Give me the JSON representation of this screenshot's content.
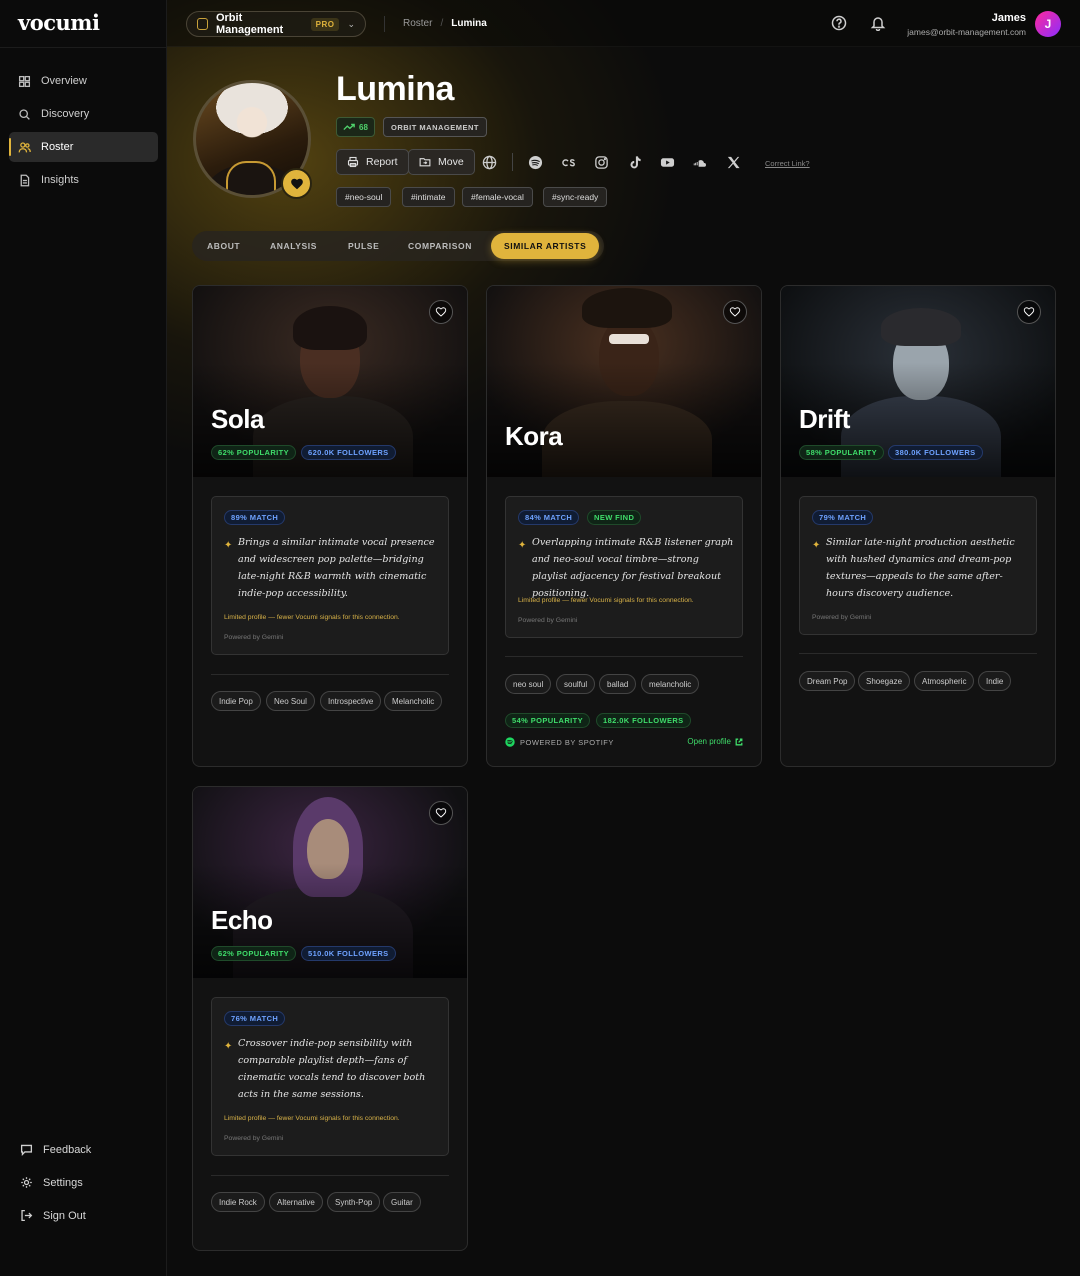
{
  "brand": {
    "logo": "vocumi",
    "accent": "#e0b43c"
  },
  "sidebar": {
    "items": [
      {
        "label": "Overview",
        "icon": "grid-icon"
      },
      {
        "label": "Discovery",
        "icon": "search-icon"
      },
      {
        "label": "Roster",
        "icon": "users-icon",
        "active": true
      },
      {
        "label": "Insights",
        "icon": "document-icon"
      }
    ],
    "bottom": [
      {
        "label": "Feedback",
        "icon": "chat-icon"
      },
      {
        "label": "Settings",
        "icon": "gear-icon"
      },
      {
        "label": "Sign Out",
        "icon": "logout-icon"
      }
    ]
  },
  "topbar": {
    "org_name": "Orbit Management",
    "org_badge": "PRO",
    "breadcrumb": [
      "Roster",
      "Lumina"
    ],
    "user_name": "James",
    "user_email": "james@orbit-management.com",
    "user_initial": "J"
  },
  "artist": {
    "name": "Lumina",
    "score": "68",
    "management": "ORBIT MANAGEMENT",
    "actions": {
      "report": "Report",
      "move": "Move"
    },
    "correct_link": "Correct Link?",
    "tags": [
      "#neo-soul",
      "#intimate",
      "#female-vocal",
      "#sync-ready"
    ]
  },
  "tabs": [
    "ABOUT",
    "ANALYSIS",
    "PULSE",
    "COMPARISON",
    "SIMILAR ARTISTS"
  ],
  "cards": [
    {
      "name": "Sola",
      "popularity": "62% POPULARITY",
      "followers": "620.0K FOLLOWERS",
      "match": "89% MATCH",
      "insight": "Brings a similar intimate vocal presence and widescreen pop palette—bridging late-night R&B warmth with cinematic indie-pop accessibility.",
      "limited": "Limited profile — fewer Vocumi signals for this connection.",
      "powered": "Powered by Gemini",
      "genres": [
        "Indie Pop",
        "Neo Soul",
        "Introspective",
        "Melancholic"
      ]
    },
    {
      "name": "Kora",
      "match": "84% MATCH",
      "new_find": "NEW FIND",
      "insight": "Overlapping intimate R&B listener graph and neo-soul vocal timbre—strong playlist adjacency for festival breakout positioning.",
      "limited": "Limited profile — fewer Vocumi signals for this connection.",
      "powered": "Powered by Gemini",
      "genres": [
        "neo soul",
        "soulful",
        "ballad",
        "melancholic"
      ],
      "popularity": "54% POPULARITY",
      "followers": "182.0K FOLLOWERS",
      "spotify": "POWERED BY SPOTIFY",
      "open_profile": "Open profile"
    },
    {
      "name": "Drift",
      "popularity": "58% POPULARITY",
      "followers": "380.0K FOLLOWERS",
      "match": "79% MATCH",
      "insight": "Similar late-night production aesthetic with hushed dynamics and dream-pop textures—appeals to the same after-hours discovery audience.",
      "powered": "Powered by Gemini",
      "genres": [
        "Dream Pop",
        "Shoegaze",
        "Atmospheric",
        "Indie"
      ]
    },
    {
      "name": "Echo",
      "popularity": "62% POPULARITY",
      "followers": "510.0K FOLLOWERS",
      "match": "76% MATCH",
      "insight": "Crossover indie-pop sensibility with comparable playlist depth—fans of cinematic vocals tend to discover both acts in the same sessions.",
      "limited": "Limited profile — fewer Vocumi signals for this connection.",
      "powered": "Powered by Gemini",
      "genres": [
        "Indie Rock",
        "Alternative",
        "Synth-Pop",
        "Guitar"
      ]
    }
  ]
}
